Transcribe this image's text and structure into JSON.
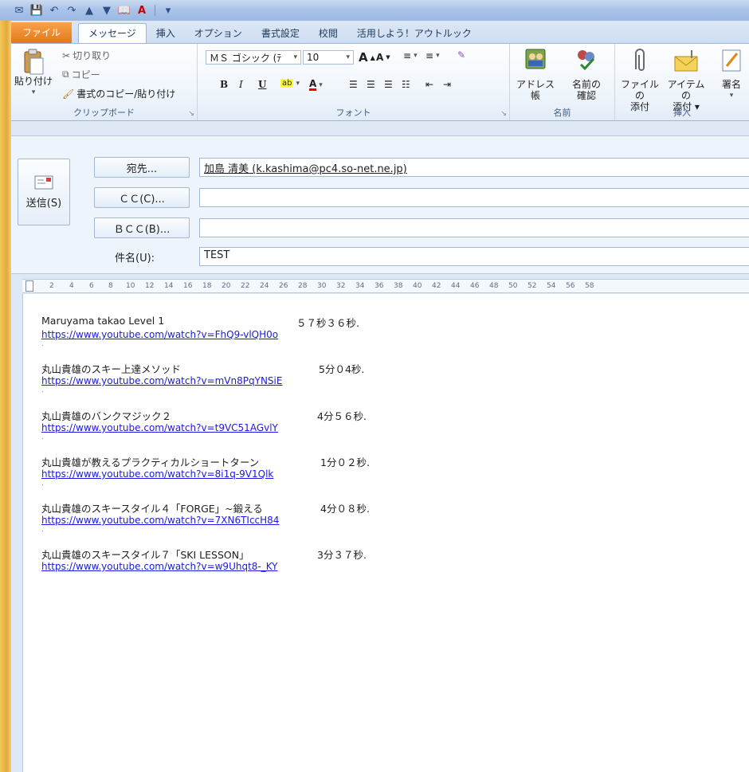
{
  "quick_access": [
    "save-icon",
    "undo-icon",
    "redo-icon",
    "up-icon",
    "down-icon",
    "address-book-icon",
    "text-color-icon",
    "customize-icon"
  ],
  "tabs": [
    "ファイル",
    "メッセージ",
    "挿入",
    "オプション",
    "書式設定",
    "校閲",
    "活用しよう！アウトルック"
  ],
  "active_tab": "メッセージ",
  "ribbon": {
    "clipboard": {
      "paste": "貼り付け",
      "cut": "切り取り",
      "copy": "コピー",
      "format_painter": "書式のコピー/貼り付け",
      "label": "クリップボード"
    },
    "font": {
      "font_name": "ＭＳ ゴシック (ﾃ",
      "font_size": "10",
      "bold": "B",
      "italic": "I",
      "underline": "U",
      "label": "フォント"
    },
    "names": {
      "address_book": "アドレス帳",
      "check_names_1": "名前の",
      "check_names_2": "確認",
      "label": "名前"
    },
    "include": {
      "attach_file_1": "ファイルの",
      "attach_file_2": "添付",
      "attach_item_1": "アイテムの",
      "attach_item_2": "添付 ▾",
      "signature": "署名",
      "label": "挿入"
    }
  },
  "compose": {
    "send": "送信(S)",
    "to_button": "宛先...",
    "cc_button": "ＣＣ(C)...",
    "bcc_button": "ＢＣＣ(B)...",
    "subject_label": "件名(U):",
    "to_value": "加島 清美 (k.kashima@pc4.so-net.ne.jp)",
    "cc_value": "",
    "bcc_value": "",
    "subject_value": "TEST"
  },
  "ruler_ticks": [
    "2",
    "4",
    "6",
    "8",
    "10",
    "12",
    "14",
    "16",
    "18",
    "20",
    "22",
    "24",
    "26",
    "28",
    "30",
    "32",
    "34",
    "36",
    "38",
    "40",
    "42",
    "44",
    "46",
    "48",
    "50",
    "52",
    "54",
    "56",
    "58"
  ],
  "entries": [
    {
      "title": "Maruyama takao Level 1",
      "duration": "５７秒３６秒.",
      "url": "https://www.youtube.com/watch?v=FhQ9-vlQH0o"
    },
    {
      "title": "丸山貴雄のスキー上達メソッド",
      "duration": "5分０4秒.",
      "url": "https://www.youtube.com/watch?v=mVn8PqYNSiE"
    },
    {
      "title": "丸山貴雄のバンクマジック２",
      "duration": "4分５６秒.",
      "url": "https://www.youtube.com/watch?v=t9VC51AGvlY"
    },
    {
      "title": "丸山貴雄が教えるプラクティカルショートターン",
      "duration": "1分０２秒.",
      "url": "https://www.youtube.com/watch?v=8i1q-9V1Qlk"
    },
    {
      "title": "丸山貴雄のスキースタイル４「FORGE」~鍛える",
      "duration": "4分０８秒.",
      "url": "https://www.youtube.com/watch?v=7XN6TIccH84"
    },
    {
      "title": "丸山貴雄のスキースタイル７「SKI LESSON」",
      "duration": "3分３７秒.",
      "url": "https://www.youtube.com/watch?v=w9Uhqt8-_KY"
    }
  ],
  "colors": {
    "link": "#1a1ae0",
    "file_tab": "#e5771a",
    "ribbon": "#eef4fb"
  }
}
